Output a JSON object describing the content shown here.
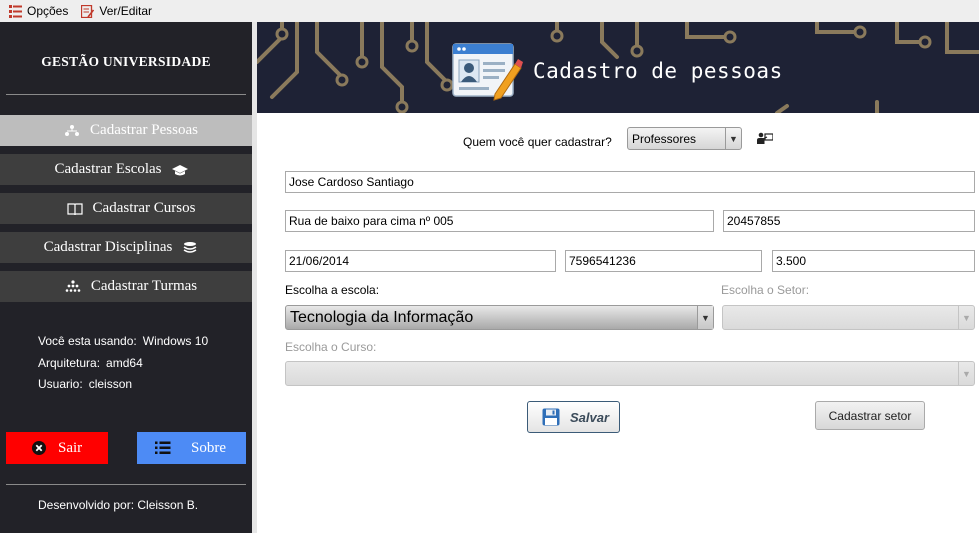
{
  "menubar": {
    "items": [
      {
        "label": "Opções",
        "icon": "list-icon"
      },
      {
        "label": "Ver/Editar",
        "icon": "edit-icon"
      }
    ]
  },
  "sidebar": {
    "brand": "GESTÃO UNIVERSIDADE",
    "nav": [
      {
        "label": "Cadastrar Pessoas",
        "icon": "people-hierarchy-icon",
        "icon_side": "left",
        "active": true
      },
      {
        "label": "Cadastrar Escolas",
        "icon": "graduation-cap-icon",
        "icon_side": "right",
        "active": false
      },
      {
        "label": "Cadastrar Cursos",
        "icon": "book-icon",
        "icon_side": "left",
        "active": false
      },
      {
        "label": "Cadastrar Disciplinas",
        "icon": "stack-icon",
        "icon_side": "right",
        "active": false
      },
      {
        "label": "Cadastrar Turmas",
        "icon": "group-icon",
        "icon_side": "left",
        "active": false
      }
    ],
    "system_info": {
      "os_label": "Você esta usando:",
      "os_value": "Windows 10",
      "arch_label": "Arquitetura:",
      "arch_value": "amd64",
      "user_label": "Usuario:",
      "user_value": "cleisson"
    },
    "exit_label": "Sair",
    "about_label": "Sobre",
    "developer": "Desenvolvido por: Cleisson B."
  },
  "header": {
    "title": "Cadastro de pessoas",
    "icon": "id-card-icon"
  },
  "form": {
    "who_label": "Quem você quer cadastrar?",
    "who_value": "Professores",
    "name": "Jose Cardoso Santiago",
    "address": "Rua de baixo para cima nº 005",
    "cep": "20457855",
    "birth_date": "21/06/2014",
    "document": "7596541236",
    "salary": "3.500",
    "school_label": "Escolha a escola:",
    "school_value": "Tecnologia da Informação",
    "sector_label": "Escolha o Setor:",
    "sector_value": "",
    "course_label": "Escolha o Curso:",
    "course_value": "",
    "save_label": "Salvar",
    "register_sector_label": "Cadastrar setor"
  },
  "colors": {
    "sidebar_bg": "#222228",
    "nav_bg": "#3e3e3e",
    "nav_active": "#bdbdbd",
    "exit": "#ff0000",
    "about": "#4d8bf5",
    "banner_bg": "#1e2235"
  }
}
